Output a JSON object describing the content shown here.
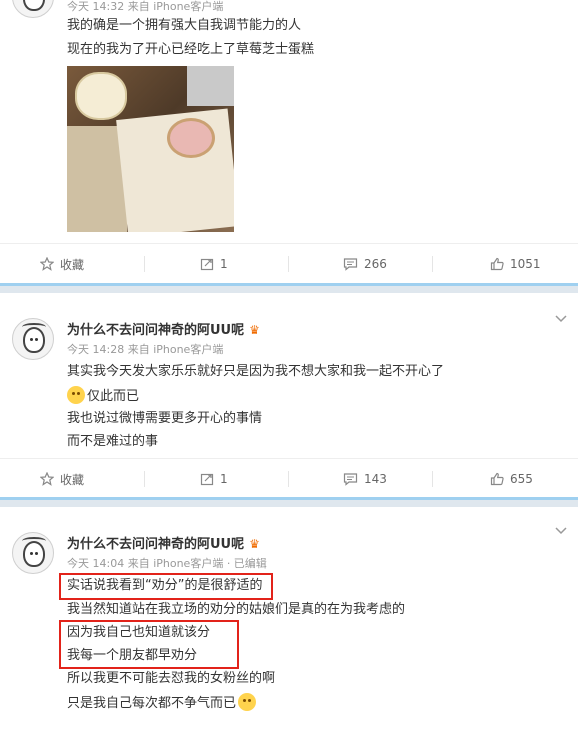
{
  "post1": {
    "meta": "今天 14:32 来自 iPhone客户端",
    "lines": [
      "我的确是一个拥有强大自我调节能力的人",
      "现在的我为了开心已经吃上了草莓芝士蛋糕"
    ],
    "photo_alt": "草莓芝士蛋糕",
    "actions": {
      "favorite": "收藏",
      "repost": "1",
      "comment": "266",
      "like": "1051"
    }
  },
  "post2": {
    "name": "为什么不去问问神奇的阿UU呢",
    "badge": "♛",
    "meta": "今天 14:28 来自 iPhone客户端",
    "lines": [
      "其实我今天发大家乐乐就好只是因为我不想大家和我一起不开心了",
      "仅此而已",
      "我也说过微博需要更多开心的事情",
      "而不是难过的事"
    ],
    "actions": {
      "favorite": "收藏",
      "repost": "1",
      "comment": "143",
      "like": "655"
    }
  },
  "post3": {
    "name": "为什么不去问问神奇的阿UU呢",
    "badge": "♛",
    "meta": "今天 14:04 来自 iPhone客户端 · 已编辑",
    "lines": [
      "实话说我看到“劝分”的是很舒适的",
      "我当然知道站在我立场的劝分的姑娘们是真的在为我考虑的",
      "因为我自己也知道就该分",
      "我每一个朋友都早劝分",
      "所以我更不可能去怼我的女粉丝的啊",
      "只是我自己每次都不争气而已"
    ]
  },
  "icons": {
    "favorite": "star-icon",
    "repost": "share-icon",
    "comment": "comment-icon",
    "like": "thumbs-up-icon",
    "more": "chevron-down-icon"
  },
  "colors": {
    "highlight_box": "#e2231a",
    "divider": "#9fd0f0",
    "badge": "#f06b00"
  }
}
